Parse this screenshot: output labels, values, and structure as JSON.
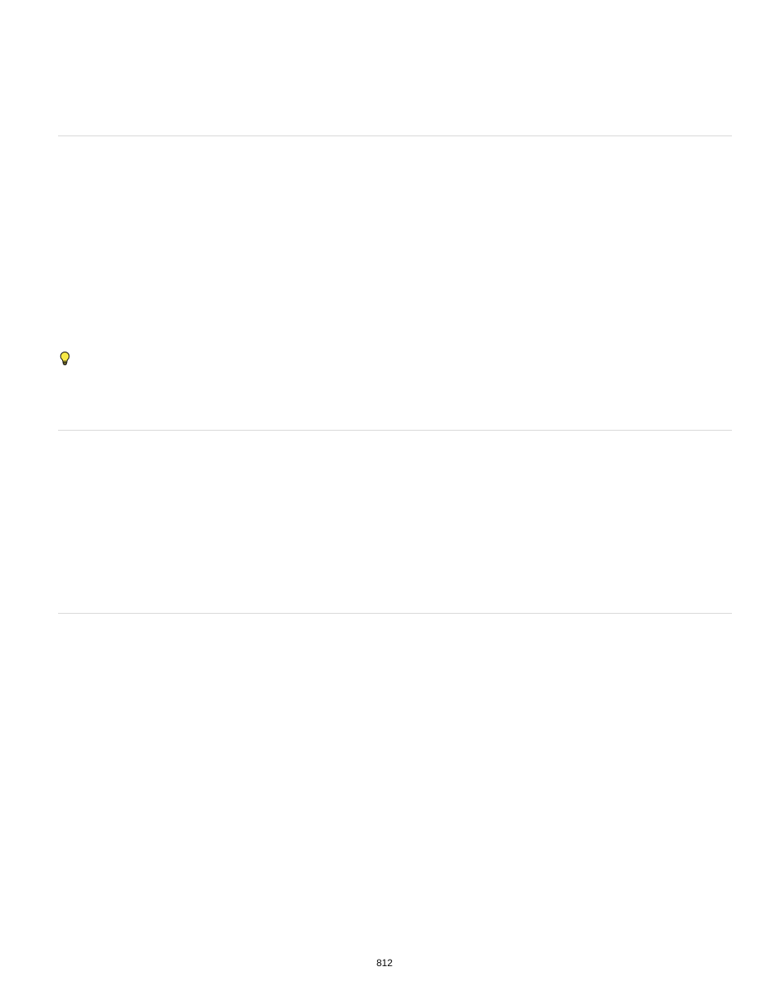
{
  "page": {
    "number": "812"
  }
}
